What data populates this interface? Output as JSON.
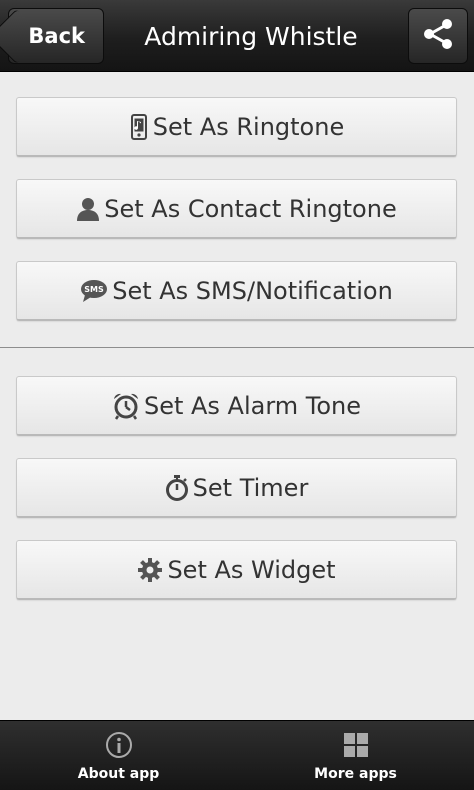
{
  "header": {
    "back_label": "Back",
    "title": "Admiring Whistle",
    "share_icon": "share-icon"
  },
  "group1": [
    {
      "label": "Set As Ringtone",
      "icon": "phone-icon"
    },
    {
      "label": "Set As Contact Ringtone",
      "icon": "person-icon"
    },
    {
      "label": "Set As SMS/Notification",
      "icon": "sms-icon",
      "icon_text": "SMS"
    }
  ],
  "group2": [
    {
      "label": "Set As Alarm Tone",
      "icon": "alarm-clock-icon"
    },
    {
      "label": "Set Timer",
      "icon": "stopwatch-icon"
    },
    {
      "label": "Set As Widget",
      "icon": "gear-icon"
    }
  ],
  "bottom_bar": {
    "about_label": "About app",
    "about_icon": "info-icon",
    "more_label": "More apps",
    "more_icon": "grid-icon"
  },
  "colors": {
    "header_bg": "#1e1e1e",
    "button_bg": "#f0f0f0",
    "button_text": "#333333",
    "page_bg": "#ececec"
  }
}
